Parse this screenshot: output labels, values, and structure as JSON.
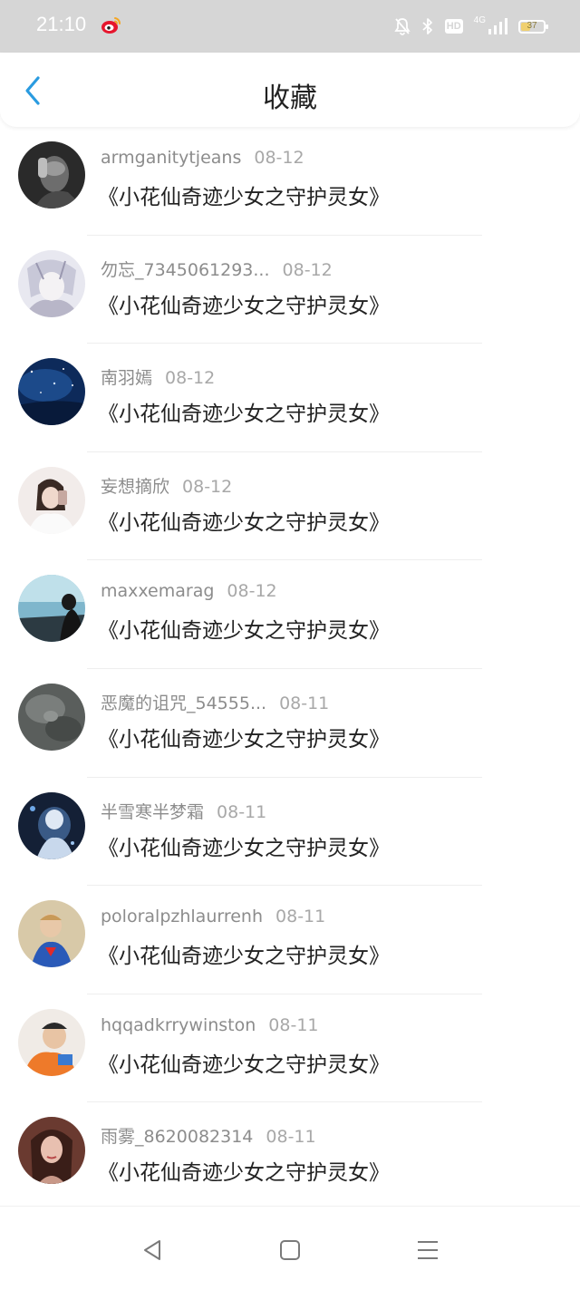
{
  "status_bar": {
    "time": "21:10",
    "network_label": "4G",
    "hd_label": "HD",
    "battery_level": "37",
    "battery_color": "#f0d070"
  },
  "header": {
    "title": "收藏",
    "back_icon": "chevron-left-icon",
    "accent_color": "#2a9be0"
  },
  "items": [
    {
      "user": "armganitytjeans",
      "date": "08-12",
      "title": "《小花仙奇迹少女之守护灵女》"
    },
    {
      "user": "勿忘_7345061293...",
      "date": "08-12",
      "title": "《小花仙奇迹少女之守护灵女》"
    },
    {
      "user": "南羽嫣",
      "date": "08-12",
      "title": "《小花仙奇迹少女之守护灵女》"
    },
    {
      "user": "妄想摘欣",
      "date": "08-12",
      "title": "《小花仙奇迹少女之守护灵女》"
    },
    {
      "user": "maxxemarag",
      "date": "08-12",
      "title": "《小花仙奇迹少女之守护灵女》"
    },
    {
      "user": "恶魔的诅咒_54555...",
      "date": "08-11",
      "title": "《小花仙奇迹少女之守护灵女》"
    },
    {
      "user": "半雪寒半梦霜",
      "date": "08-11",
      "title": "《小花仙奇迹少女之守护灵女》"
    },
    {
      "user": "poloralpzhlaurrenh",
      "date": "08-11",
      "title": "《小花仙奇迹少女之守护灵女》"
    },
    {
      "user": "hqqadkrrywinston",
      "date": "08-11",
      "title": "《小花仙奇迹少女之守护灵女》"
    },
    {
      "user": "雨雾_8620082314",
      "date": "08-11",
      "title": "《小花仙奇迹少女之守护灵女》"
    }
  ],
  "nav_bar": {
    "back_icon": "triangle-back-icon",
    "home_icon": "square-home-icon",
    "menu_icon": "hamburger-menu-icon"
  }
}
